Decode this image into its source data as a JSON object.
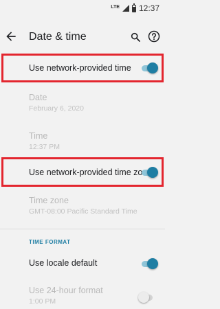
{
  "status_bar": {
    "network": "LTE",
    "time": "12:37"
  },
  "toolbar": {
    "title": "Date & time",
    "back_icon": "arrow-left-icon",
    "search_icon": "search-icon",
    "help_icon": "help-icon"
  },
  "settings": {
    "network_time": {
      "label": "Use network-provided time",
      "enabled": true,
      "highlighted": true
    },
    "date": {
      "label": "Date",
      "value": "February 6, 2020",
      "disabled": true
    },
    "time": {
      "label": "Time",
      "value": "12:37 PM",
      "disabled": true
    },
    "network_time_zone": {
      "label": "Use network-provided time zone",
      "enabled": true,
      "highlighted": true
    },
    "time_zone": {
      "label": "Time zone",
      "value": "GMT-08:00 Pacific Standard Time",
      "disabled": true
    }
  },
  "time_format": {
    "header": "TIME FORMAT",
    "locale_default": {
      "label": "Use locale default",
      "enabled": true
    },
    "hour24": {
      "label": "Use 24-hour format",
      "value": "1:00 PM",
      "enabled": false,
      "disabled": true
    }
  },
  "colors": {
    "accent": "#1f7ea3",
    "highlight": "#e3262f",
    "background": "#f2f2f2"
  }
}
